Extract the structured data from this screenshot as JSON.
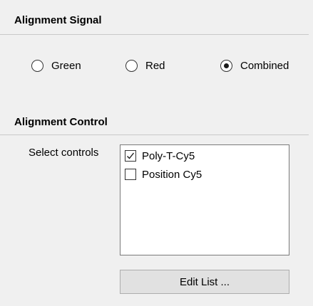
{
  "alignment_signal": {
    "title": "Alignment Signal",
    "options": [
      {
        "label": "Green",
        "selected": false
      },
      {
        "label": "Red",
        "selected": false
      },
      {
        "label": "Combined",
        "selected": true
      }
    ]
  },
  "alignment_control": {
    "title": "Alignment Control",
    "select_label": "Select controls",
    "items": [
      {
        "label": "Poly-T-Cy5",
        "checked": true
      },
      {
        "label": "Position Cy5",
        "checked": false
      }
    ],
    "edit_button_label": "Edit List ..."
  },
  "icons": {
    "checkmark": "checkmark-icon"
  }
}
